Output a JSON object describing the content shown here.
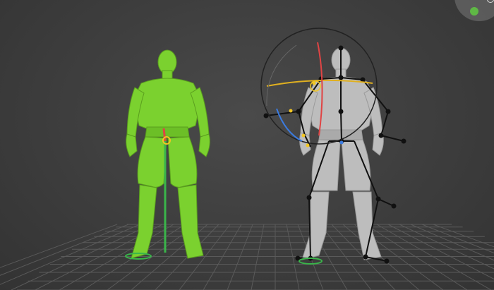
{
  "colors": {
    "background": "#3c3c3c",
    "grid": "#5a5a5a",
    "selected_mesh": "#7bd12f",
    "unselected_mesh": "#bdbdbd",
    "bone": "#111111",
    "joint_selected": "#f2c623",
    "axis_x": "#e04444",
    "axis_y": "#3ab54a",
    "axis_z": "#3b7be0",
    "rotate_ring": "#222222",
    "rotate_track": "#e0b020",
    "gizmo_dot": "#5fb845"
  },
  "viewport": {
    "characters": [
      {
        "name": "character-selected",
        "state": "selected"
      },
      {
        "name": "character-rigged",
        "state": "posed"
      }
    ],
    "view_gizmo_icon": "navigation-gizmo-icon",
    "rotate_manipulator_icon": "rotate-manipulator-icon",
    "translate_manipulator_icon": "translate-manipulator-icon"
  }
}
